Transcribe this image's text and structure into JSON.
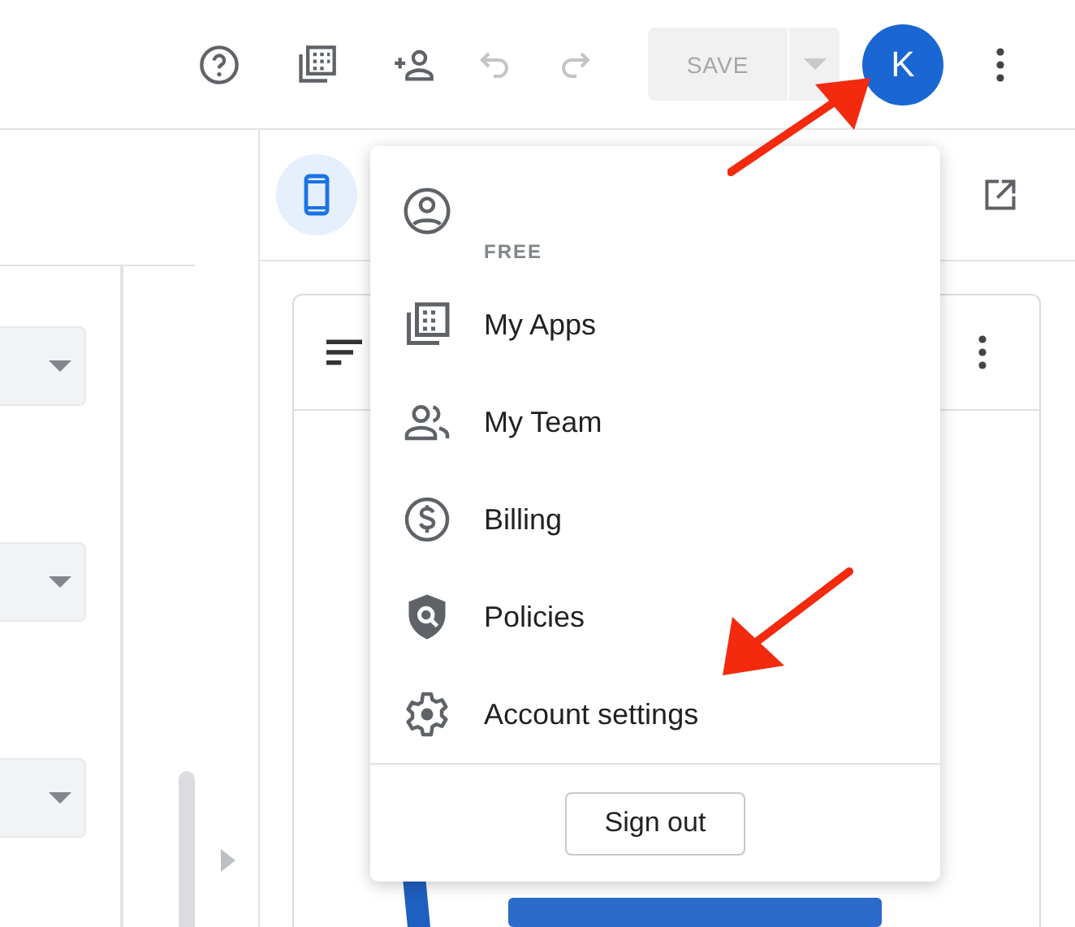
{
  "toolbar": {
    "undo": {
      "disabled": true
    },
    "redo": {
      "disabled": true
    },
    "save": {
      "label": "SAVE",
      "disabled": true
    },
    "avatar": "K"
  },
  "account_menu": {
    "plan": "FREE",
    "items": [
      {
        "kind": "apps",
        "label": "My Apps"
      },
      {
        "kind": "team",
        "label": "My Team"
      },
      {
        "kind": "billing",
        "label": "Billing"
      },
      {
        "kind": "policies",
        "label": "Policies"
      },
      {
        "kind": "settings",
        "label": "Account settings"
      }
    ],
    "sign_out": "Sign out"
  },
  "preview": {
    "device": {
      "selected": true
    }
  }
}
